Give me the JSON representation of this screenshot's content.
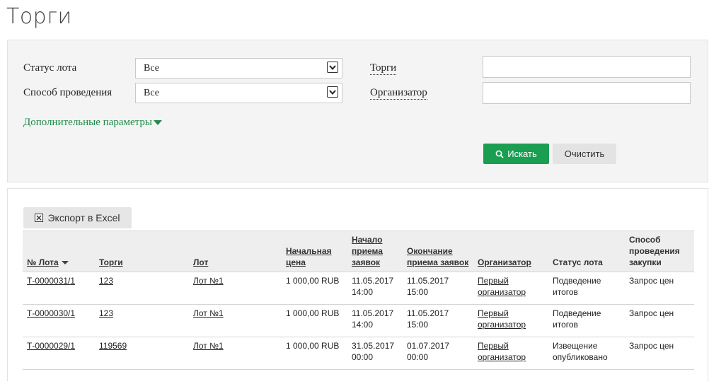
{
  "page": {
    "title": "Торги"
  },
  "filters": {
    "lot_status": {
      "label": "Статус лота",
      "value": "Все"
    },
    "method": {
      "label": "Способ проведения",
      "value": "Все"
    },
    "auction": {
      "label": "Торги",
      "value": ""
    },
    "organizer": {
      "label": "Организатор",
      "value": ""
    },
    "advanced_label": "Дополнительные параметры",
    "search_label": "Искать",
    "clear_label": "Очистить"
  },
  "results": {
    "export_label": "Экспорт в Excel",
    "columns": [
      "№ Лота",
      "Торги",
      "Лот",
      "Начальная цена",
      "Начало приема заявок",
      "Окончание приема заявок",
      "Организатор",
      "Статус лота",
      "Способ проведения закупки"
    ],
    "rows": [
      {
        "lot_no": "Т-0000031/1",
        "auction": "123",
        "lot": "Лот №1",
        "price": "1 000,00 RUB",
        "start": "11.05.2017 14:00",
        "end": "11.05.2017 15:00",
        "organizer": "Первый организатор",
        "status": "Подведение итогов",
        "method": "Запрос цен"
      },
      {
        "lot_no": "Т-0000030/1",
        "auction": "123",
        "lot": "Лот №1",
        "price": "1 000,00 RUB",
        "start": "11.05.2017 14:00",
        "end": "11.05.2017 15:00",
        "organizer": "Первый организатор",
        "status": "Подведение итогов",
        "method": "Запрос цен"
      },
      {
        "lot_no": "Т-0000029/1",
        "auction": "119569",
        "lot": "Лот №1",
        "price": "1 000,00 RUB",
        "start": "31.05.2017 00:00",
        "end": "01.07.2017 00:00",
        "organizer": "Первый организатор",
        "status": "Извещение опубликовано",
        "method": "Запрос цен"
      }
    ]
  },
  "colors": {
    "accent": "#1a9e52",
    "link_green": "#1f8a4c",
    "panel_bg": "#f4f4f4",
    "header_bg": "#eeeeee"
  }
}
